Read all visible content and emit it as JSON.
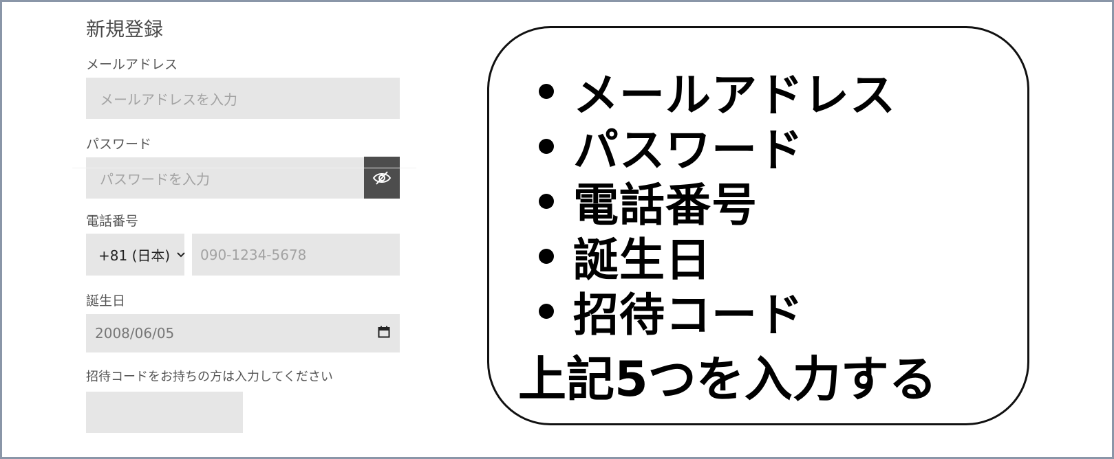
{
  "form": {
    "title": "新規登録",
    "email": {
      "label": "メールアドレス",
      "placeholder": "メールアドレスを入力"
    },
    "password": {
      "label": "パスワード",
      "placeholder": "パスワードを入力",
      "toggle_icon": "eye-slash-icon"
    },
    "phone": {
      "label": "電話番号",
      "country_code": "+81 (日本)",
      "placeholder": "090-1234-5678"
    },
    "birthday": {
      "label": "誕生日",
      "value": "2008/06/05",
      "icon": "calendar-icon"
    },
    "invite": {
      "label": "招待コードをお持ちの方は入力してください",
      "value": ""
    }
  },
  "callout": {
    "items": [
      "メールアドレス",
      "パスワード",
      "電話番号",
      "誕生日",
      "招待コード"
    ],
    "footer": "上記5つを入力する"
  },
  "colors": {
    "field_bg": "#e6e6e6",
    "button_bg": "#4d4d4d",
    "frame_border": "#8a96a8"
  }
}
